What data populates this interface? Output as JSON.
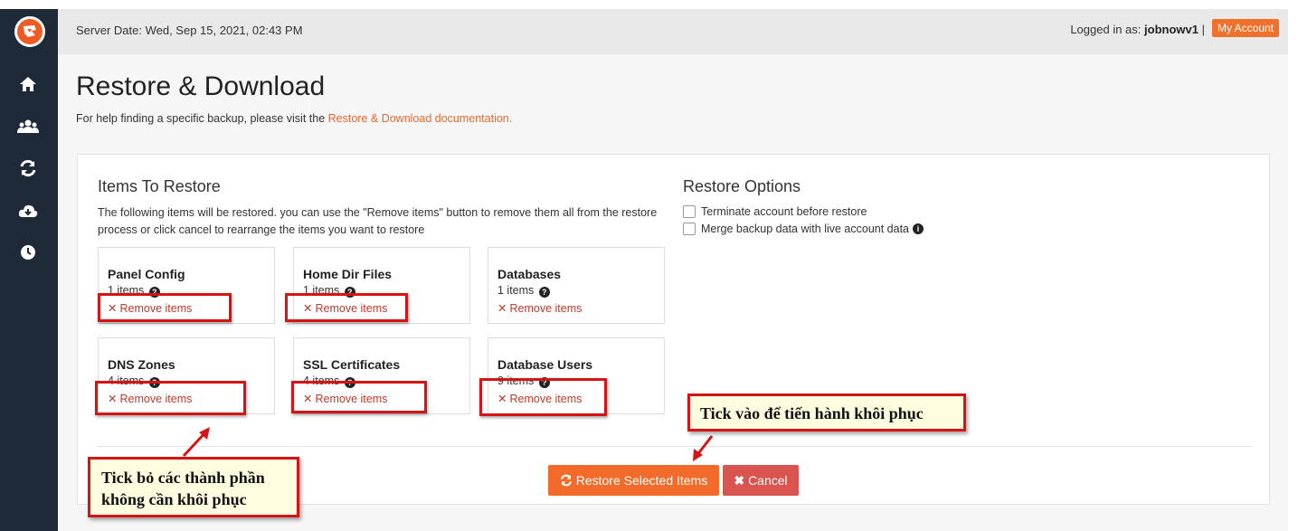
{
  "header": {
    "server_date": "Server Date: Wed, Sep 15, 2021, 02:43 PM",
    "logged_in_label": "Logged in as:",
    "username": "jobnowv1",
    "separator": "|",
    "my_account": "My Account"
  },
  "sidebar": {
    "items": [
      {
        "icon": "home-icon"
      },
      {
        "icon": "users-icon"
      },
      {
        "icon": "refresh-icon"
      },
      {
        "icon": "cloud-download-icon"
      },
      {
        "icon": "clock-icon"
      }
    ]
  },
  "page": {
    "title": "Restore & Download",
    "help_text": "For help finding a specific backup, please visit the",
    "help_link": "Restore & Download documentation."
  },
  "items_to_restore": {
    "title": "Items To Restore",
    "description": "The following items will be restored. you can use the \"Remove items\" button to remove them all from the restore process or click cancel to rearrange the items you want to restore",
    "remove_label": "Remove items",
    "cards": [
      {
        "title": "Panel Config",
        "count": "1 items"
      },
      {
        "title": "Home Dir Files",
        "count": "1 items"
      },
      {
        "title": "Databases",
        "count": "1 items"
      },
      {
        "title": "DNS Zones",
        "count": "4 items"
      },
      {
        "title": "SSL Certificates",
        "count": "4 items"
      },
      {
        "title": "Database Users",
        "count": "9 items"
      }
    ]
  },
  "restore_options": {
    "title": "Restore Options",
    "options": [
      {
        "label": "Terminate account before restore",
        "checked": false
      },
      {
        "label": "Merge backup data with live account data",
        "checked": false
      }
    ]
  },
  "actions": {
    "restore": "Restore Selected Items",
    "cancel": "Cancel"
  },
  "annotations": {
    "callout_remove": "Tick bỏ các thành phần không cần khôi phục",
    "callout_restore": "Tick vào để tiến hành khôi phục"
  },
  "colors": {
    "accent": "#f26b2a",
    "danger": "#d9534f",
    "sidebar": "#1f2a38",
    "annotation_border": "#d31515"
  }
}
